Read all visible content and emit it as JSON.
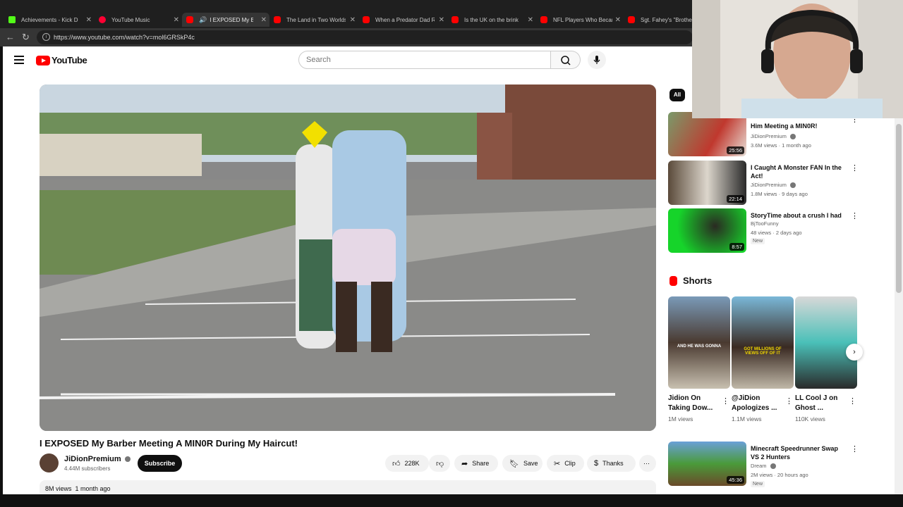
{
  "browser": {
    "tabs": [
      {
        "title": "Achievements - Kick D",
        "color": "#53fc18"
      },
      {
        "title": "YouTube Music",
        "color": "#ff0033"
      },
      {
        "title": "I EXPOSED My Barb",
        "color": "#ff0000",
        "active": true
      },
      {
        "title": "The Land in Two Worlds",
        "color": "#ff0000"
      },
      {
        "title": "When a Predator Dad R",
        "color": "#ff0000"
      },
      {
        "title": "Is the UK on the brink",
        "color": "#ff0000"
      },
      {
        "title": "NFL Players Who Becam",
        "color": "#ff0000"
      },
      {
        "title": "Sgt. Fahey's \"Brothers",
        "color": "#ff0000"
      }
    ],
    "url": "https://www.youtube.com/watch?v=mol6GRSkP4c"
  },
  "header": {
    "logo_text": "YouTube",
    "search_placeholder": "Search"
  },
  "video": {
    "title": "I EXPOSED My Barber Meeting A MIN0R During My Haircut!",
    "channel": "JiDionPremium",
    "subscribers": "4.44M subscribers",
    "subscribe_label": "Subscribe",
    "likes": "228K",
    "share_label": "Share",
    "save_label": "Save",
    "clip_label": "Clip",
    "thanks_label": "Thanks",
    "views": "8M views",
    "age": "1 month ago"
  },
  "sidebar": {
    "filter_chip": "All",
    "recommendations": [
      {
        "title": "Him Meeting a MIN0R!",
        "channel": "JiDionPremium",
        "meta": "3.6M views · 1 month ago",
        "duration": "25:56",
        "verified": true,
        "new": ""
      },
      {
        "title": "I Caught A Monster FAN In the Act!",
        "channel": "JiDionPremium",
        "meta": "1.8M views · 9 days ago",
        "duration": "22:14",
        "verified": true,
        "new": ""
      },
      {
        "title": "StoryTime about a crush I had",
        "channel": "BjTooFunny",
        "meta": "48 views · 2 days ago",
        "duration": "8:57",
        "verified": false,
        "new": "New"
      },
      {
        "title": "Minecraft Speedrunner Swap VS 2 Hunters",
        "channel": "Dream",
        "meta": "2M views · 20 hours ago",
        "duration": "45:36",
        "verified": true,
        "new": "New"
      }
    ],
    "shorts_heading": "Shorts",
    "shorts": [
      {
        "title": "Jidion On Taking Dow...",
        "views": "1M views",
        "caption": "AND HE WAS GONNA"
      },
      {
        "title": "@JiDion Apologizes ...",
        "views": "1.1M views",
        "caption": "GOT MILLIONS OF VIEWS OFF OF IT"
      },
      {
        "title": "LL Cool J on Ghost ...",
        "views": "110K views",
        "caption": ""
      }
    ]
  },
  "colors": {
    "brand_red": "#ff0000",
    "text_primary": "#0f0f0f",
    "text_secondary": "#606060",
    "chip_bg": "#f2f2f2"
  }
}
